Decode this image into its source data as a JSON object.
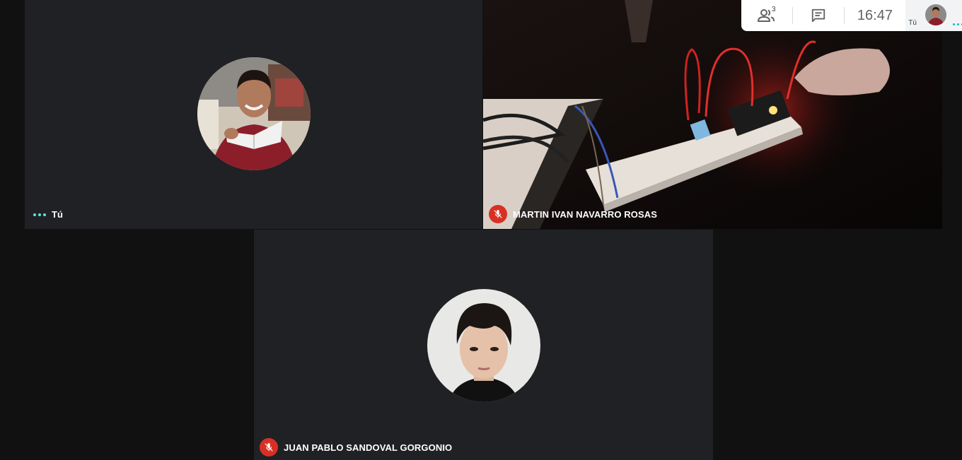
{
  "topbar": {
    "people_icon": "people-icon",
    "participant_count": "3",
    "chat_icon": "chat-icon",
    "time": "16:47",
    "self_label": "Tú"
  },
  "tiles": {
    "self": {
      "name": "Tú",
      "status_icon": "speaking-dots-icon"
    },
    "martin": {
      "name": "MARTIN IVAN NAVARRO ROSAS",
      "status_icon": "mic-off-icon"
    },
    "juan": {
      "name": "JUAN PABLO SANDOVAL GORGONIO",
      "status_icon": "mic-off-icon"
    }
  },
  "colors": {
    "tile_bg": "#202124",
    "page_bg": "#111112",
    "mic_off": "#d93025",
    "speaking": "#5ee3e0"
  }
}
